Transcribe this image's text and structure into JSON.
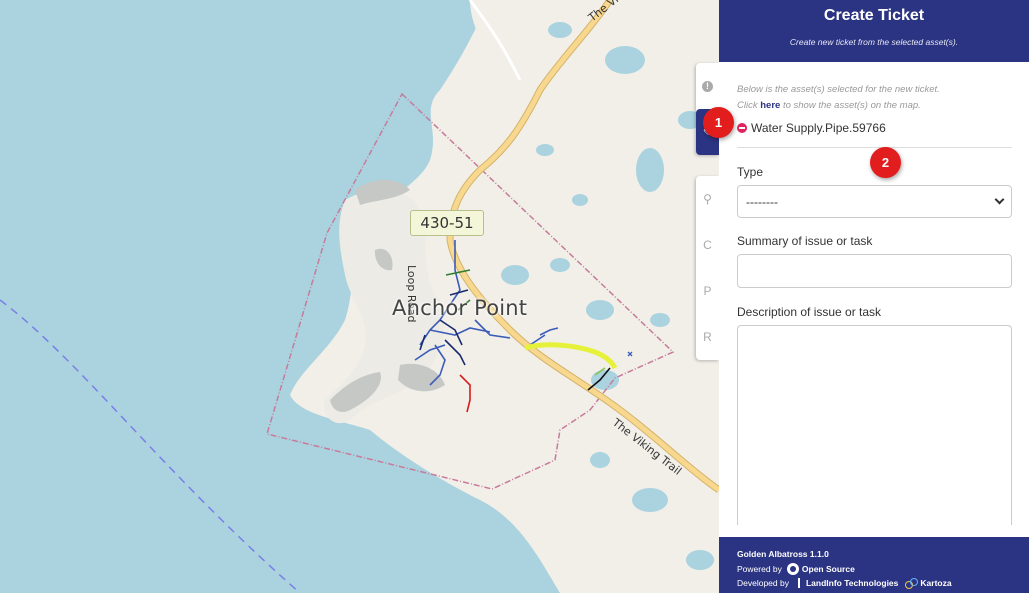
{
  "map": {
    "town_label": "Anchor Point",
    "route_shield": "430-51",
    "road_loop": "Loop Road",
    "road_viking_lower": "The Viking Trail",
    "road_viking_upper": "The Vi"
  },
  "side_tabs": {
    "tab_c": "C",
    "tab_p": "P",
    "tab_r": "R"
  },
  "panel": {
    "title": "Create Ticket",
    "subtitle": "Create new ticket from the selected asset(s).",
    "help_line1": "Below is the asset(s) selected for the new ticket.",
    "help_click": "Click",
    "help_link": "here",
    "help_rest": "to show the asset(s) on the map.",
    "assets": [
      {
        "name": "Water Supply.Pipe.59766"
      }
    ],
    "type_label": "Type",
    "type_value": "--------",
    "summary_label": "Summary of issue or task",
    "summary_value": "",
    "description_label": "Description of issue or task",
    "description_value": ""
  },
  "footer": {
    "version": "Golden Albatross 1.1.0",
    "powered_by": "Powered by",
    "open_source": "Open Source",
    "developed_by": "Developed by",
    "landinfo": "LandInfo Technologies",
    "kartoza": "Kartoza"
  },
  "badges": [
    "1",
    "2"
  ],
  "colors": {
    "brand": "#2b3482",
    "badge": "#e11d1d",
    "remove": "#e0245e",
    "water": "#aad3df",
    "land": "#f2efe9"
  }
}
